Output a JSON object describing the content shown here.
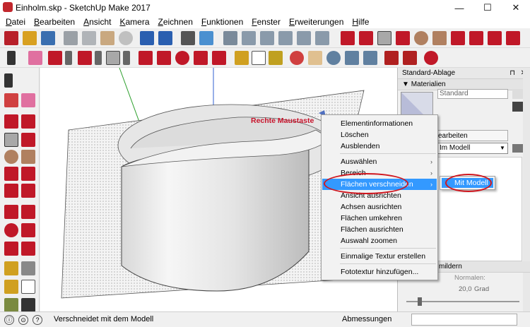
{
  "window": {
    "title": "Einholm.skp - SketchUp Make 2017",
    "minimize": "—",
    "maximize": "☐",
    "close": "✕"
  },
  "menu": [
    {
      "label": "Datei",
      "u": "D",
      "rest": "atei"
    },
    {
      "label": "Bearbeiten",
      "u": "B",
      "rest": "earbeiten"
    },
    {
      "label": "Ansicht",
      "u": "A",
      "rest": "nsicht"
    },
    {
      "label": "Kamera",
      "u": "K",
      "rest": "amera"
    },
    {
      "label": "Zeichnen",
      "u": "Z",
      "rest": "eichnen"
    },
    {
      "label": "Funktionen",
      "u": "F",
      "rest": "unktionen"
    },
    {
      "label": "Fenster",
      "u": "F",
      "rest": "enster"
    },
    {
      "label": "Erweiterungen",
      "u": "E",
      "rest": "rweiterungen"
    },
    {
      "label": "Hilfe",
      "u": "H",
      "rest": "ilfe"
    }
  ],
  "viewport": {
    "annotation": "Rechte Maustaste",
    "annotation_color": "#c8142c"
  },
  "context_menu": {
    "items": [
      {
        "label": "Elementinformationen",
        "arrow": ""
      },
      {
        "label": "Löschen",
        "arrow": ""
      },
      {
        "label": "Ausblenden",
        "arrow": ""
      },
      {
        "label": "Auswählen",
        "arrow": "›"
      },
      {
        "label": "Bereich",
        "arrow": "›"
      },
      {
        "label": "Flächen verschneiden",
        "arrow": "›",
        "highlight": true
      },
      {
        "label": "Ansicht ausrichten",
        "arrow": ""
      },
      {
        "label": "Achsen ausrichten",
        "arrow": ""
      },
      {
        "label": "Flächen umkehren",
        "arrow": ""
      },
      {
        "label": "Flächen ausrichten",
        "arrow": ""
      },
      {
        "label": "Auswahl zoomen",
        "arrow": ""
      },
      {
        "label": "Einmalige Textur erstellen",
        "arrow": ""
      },
      {
        "label": "Fototextur hinzufügen...",
        "arrow": ""
      }
    ],
    "highlight_color": "#3399ff"
  },
  "submenu": {
    "label": "Mit Modell"
  },
  "right_panel": {
    "tray_title": "Standard-Ablage",
    "section_title": "Materialien",
    "material_name": "Standard",
    "tab_label": "earbeiten",
    "dropdown_value": "Im Modell",
    "lower_section": "mildern",
    "normals_label": "Normalen:",
    "angle_value": "20,0",
    "angle_unit": "Grad"
  },
  "status": {
    "text": "Verschneidet mit dem Modell",
    "measure_label": "Abmessungen"
  },
  "icons": {
    "help": "question-icon",
    "info": "info-icon"
  }
}
